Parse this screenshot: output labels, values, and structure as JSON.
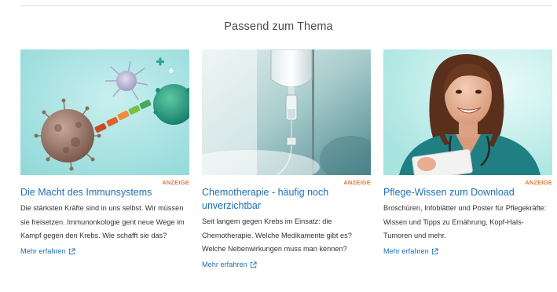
{
  "section": {
    "title": "Passend zum Thema"
  },
  "cards": [
    {
      "ad_label": "ANZEIGE",
      "title": "Die Macht des Immunsystems",
      "description": "Die stärksten Kräfte sind in uns selbst. Wir müssen sie freisetzen. Immunonkologie gent neue Wege im Kampf gegen den Krebs. Wie schafft sie das?",
      "link_label": "Mehr erfahren",
      "image": "immune-cells-illustration",
      "link_icon": "external-link-icon"
    },
    {
      "ad_label": "ANZEIGE",
      "title": "Chemotherapie - häufig noch unverzichtbar",
      "description": "Seit langem gegen Krebs im Einsatz: die Chemotherapie. Welche Medikamente gibt es? Welche Nebenwirkungen muss man kennen?",
      "link_label": "Mehr erfahren",
      "image": "iv-drip-photo",
      "link_icon": "external-link-icon"
    },
    {
      "ad_label": "ANZEIGE",
      "title": "Pflege-Wissen zum Download",
      "description": "Broschüren, Infoblätter und Poster für Pflegekräfte: Wissen und Tipps zu Ernährung, Kopf-Hals-Tumoren und mehr.",
      "link_label": "Mehr erfahren",
      "image": "nurse-photo",
      "link_icon": "external-link-icon"
    }
  ],
  "colors": {
    "link": "#1d6fb8",
    "ad_label": "#e07a3c",
    "title": "#4a4a4a"
  }
}
